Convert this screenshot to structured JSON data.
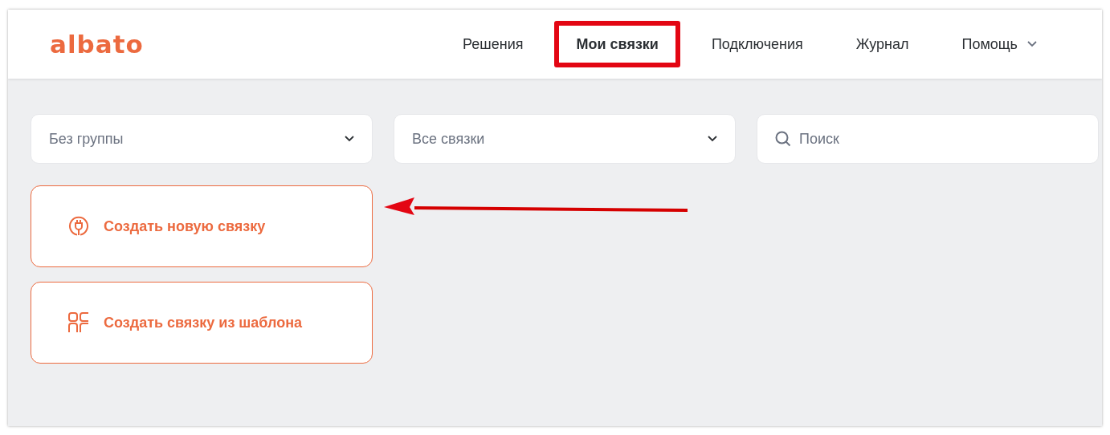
{
  "logo": "albato",
  "nav": [
    {
      "label": "Решения",
      "selected": false,
      "highlighted": false,
      "dropdown": false
    },
    {
      "label": "Мои связки",
      "selected": true,
      "highlighted": true,
      "dropdown": false
    },
    {
      "label": "Подключения",
      "selected": false,
      "highlighted": false,
      "dropdown": false
    },
    {
      "label": "Журнал",
      "selected": false,
      "highlighted": false,
      "dropdown": false
    },
    {
      "label": "Помощь",
      "selected": false,
      "highlighted": false,
      "dropdown": true
    }
  ],
  "filters": [
    {
      "kind": "select",
      "placeholder": "Без группы"
    },
    {
      "kind": "select",
      "placeholder": "Все связки"
    },
    {
      "kind": "search",
      "placeholder": "Поиск"
    }
  ],
  "actions": [
    {
      "kind": "plug",
      "label": "Создать новую связку",
      "arrow": true
    },
    {
      "kind": "template",
      "label": "Создать связку из шаблона",
      "arrow": false
    }
  ]
}
